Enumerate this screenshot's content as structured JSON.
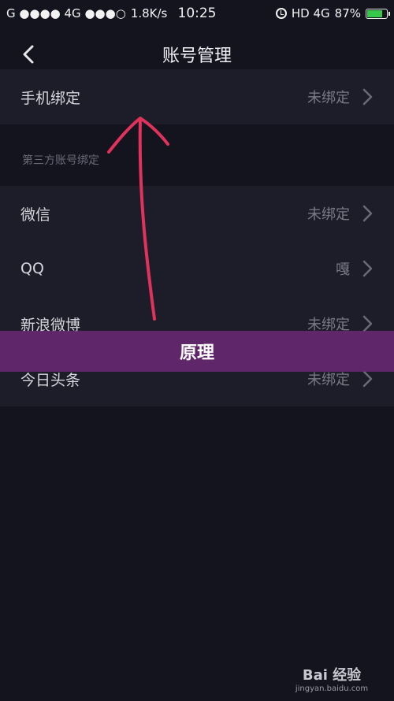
{
  "status_bar": {
    "carrier": "G ●●●● 4G ●●●○",
    "speed": "1.8K/s",
    "time": "10:25",
    "network": "HD 4G",
    "battery_percent": "87%",
    "battery_level": 0.87
  },
  "header": {
    "title": "账号管理"
  },
  "phone_binding": {
    "label": "手机绑定",
    "status": "未绑定"
  },
  "third_party": {
    "section_title": "第三方账号绑定",
    "items": [
      {
        "label": "微信",
        "status": "未绑定"
      },
      {
        "label": "QQ",
        "status": "嘎"
      },
      {
        "label": "新浪微博",
        "status": "未绑定"
      },
      {
        "label": "今日头条",
        "status": "未绑定"
      }
    ]
  },
  "banner": {
    "text": "原理"
  },
  "watermark": {
    "logo": "Bai 经验",
    "url": "jingyan.baidu.com"
  },
  "colors": {
    "background": "#14141f",
    "row_background": "#1d1d2a",
    "banner": "#6e2878",
    "annotation_arrow": "#e0325a"
  }
}
